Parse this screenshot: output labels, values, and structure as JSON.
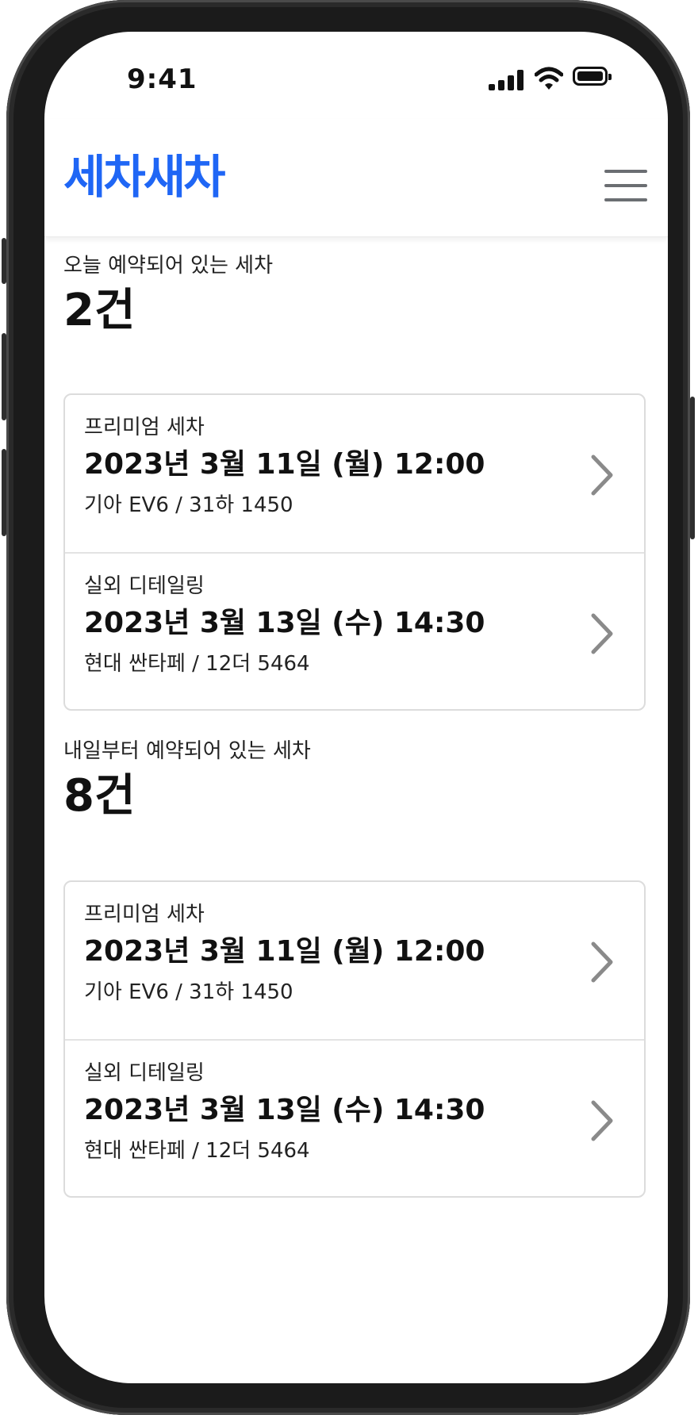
{
  "status_bar": {
    "time": "9:41"
  },
  "header": {
    "logo": "세차새차"
  },
  "sections": [
    {
      "label": "오늘 예약되어 있는 세차",
      "count": "2건",
      "items": [
        {
          "service": "프리미엄 세차",
          "datetime": "2023년 3월 11일 (월) 12:00",
          "car": "기아 EV6 / 31하 1450"
        },
        {
          "service": "실외 디테일링",
          "datetime": "2023년 3월 13일 (수) 14:30",
          "car": "현대 싼타페 / 12더 5464"
        }
      ]
    },
    {
      "label": "내일부터 예약되어 있는 세차",
      "count": "8건",
      "items": [
        {
          "service": "프리미엄 세차",
          "datetime": "2023년 3월 11일 (월) 12:00",
          "car": "기아 EV6 / 31하 1450"
        },
        {
          "service": "실외 디테일링",
          "datetime": "2023년 3월 13일 (수) 14:30",
          "car": "현대 싼타페 / 12더 5464"
        }
      ]
    }
  ],
  "icons": {
    "menu": "hamburger-menu-icon",
    "chevron": "chevron-right-icon",
    "signal": "cellular-signal-icon",
    "wifi": "wifi-icon",
    "battery": "battery-icon"
  },
  "colors": {
    "brand": "#1f66f5",
    "chevron": "#8a8a8a",
    "border": "#dcdcdc"
  }
}
